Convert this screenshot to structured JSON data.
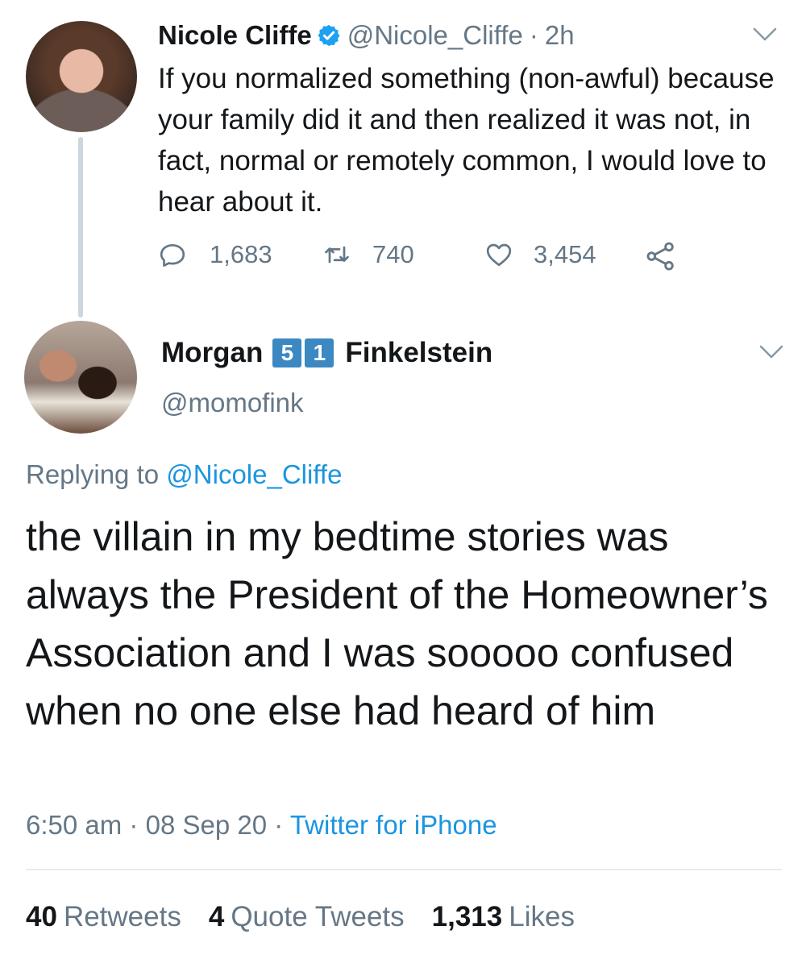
{
  "tweet1": {
    "name": "Nicole Cliffe",
    "handle": "@Nicole_Cliffe",
    "separator": "·",
    "time": "2h",
    "text": "If you normalized something (non-awful) because your family did it and then realized it was not, in fact, normal or remotely common, I would love to hear about it.",
    "replies": "1,683",
    "retweets": "740",
    "likes": "3,454"
  },
  "tweet2": {
    "name_first": "Morgan",
    "badge_1": "5",
    "badge_2": "1",
    "name_last": "Finkelstein",
    "handle": "@momofink",
    "replying_prefix": "Replying to",
    "replying_to": "@Nicole_Cliffe",
    "text": "the villain in my bedtime stories was always the President of the Homeowner’s Association and I was sooooo confused when no one else had heard of him",
    "time": "6:50 am",
    "date": "08 Sep 20",
    "source": "Twitter for iPhone",
    "dot": "·",
    "retweets_count": "40",
    "retweets_label": "Retweets",
    "quotes_count": "4",
    "quotes_label": "Quote Tweets",
    "likes_count": "1,313",
    "likes_label": "Likes"
  },
  "colors": {
    "text": "#14171a",
    "muted": "#657786",
    "link": "#1b95e0",
    "verified": "#1da1f2",
    "badge": "#3b88c3",
    "thread_line": "#ccd6dd"
  }
}
